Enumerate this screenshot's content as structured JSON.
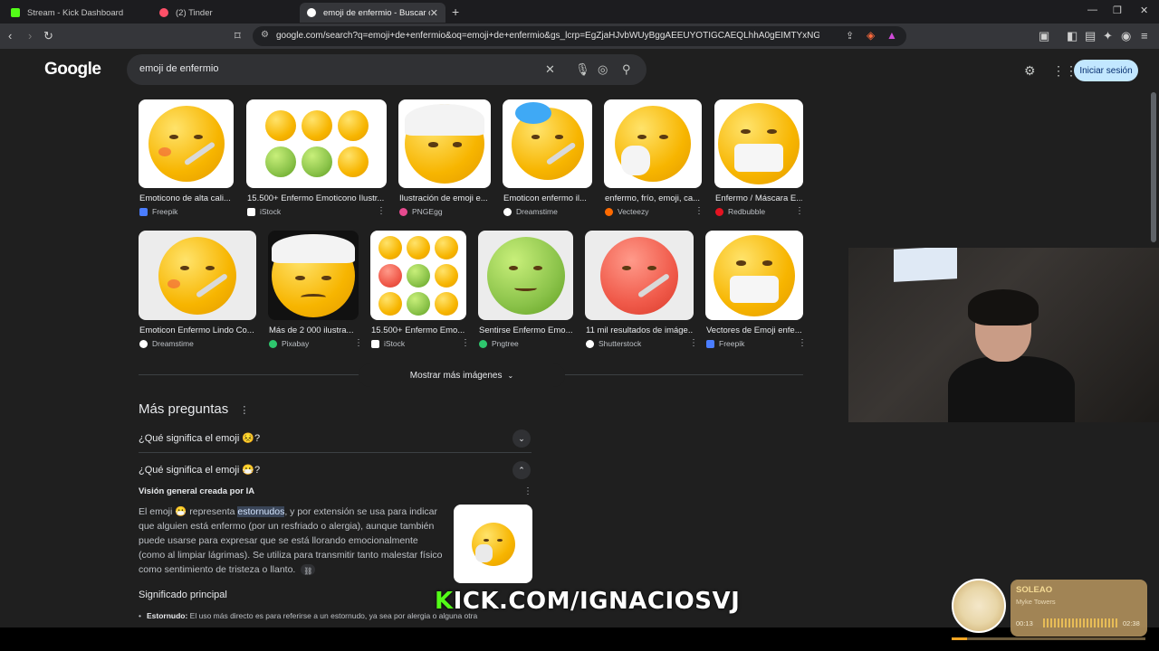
{
  "tabs": [
    {
      "label": "Stream - Kick Dashboard",
      "icon": "kick-icon"
    },
    {
      "label": "(2) Tinder",
      "icon": "tinder-icon"
    },
    {
      "label": "emoji de enfermio - Buscar con G",
      "icon": "google-icon"
    }
  ],
  "toolbar": {
    "url": "google.com/search?q=emoji+de+enfermio&oq=emoji+de+enfermio&gs_lcrp=EgZjaHJvbWUyBggAEEUYOTIGCAEQLhhA0gEIMTYxNGowajGoAgCw..."
  },
  "google": {
    "logo": "Google",
    "query": "emoji de enfermio",
    "signin": "Iniciar sesión"
  },
  "images": [
    {
      "caption": "Emoticono de alta cali...",
      "source": "Freepik",
      "src_color": "#4a7dff"
    },
    {
      "caption": "15.500+ Enfermo Emoticono Ilustr...",
      "source": "iStock",
      "src_color": "#ffffff"
    },
    {
      "caption": "Ilustración de emoji e...",
      "source": "PNGEgg",
      "src_color": "#e64a8f"
    },
    {
      "caption": "Emoticon enfermo il...",
      "source": "Dreamstime",
      "src_color": "#ffffff"
    },
    {
      "caption": "enfermo, frío, emoji, ca...",
      "source": "Vecteezy",
      "src_color": "#ff6a00"
    },
    {
      "caption": "Enfermo / Máscara E...",
      "source": "Redbubble",
      "src_color": "#e41321"
    },
    {
      "caption": "Emoticon Enfermo Lindo Co...",
      "source": "Dreamstime",
      "src_color": "#ffffff"
    },
    {
      "caption": "Más de 2 000 ilustra...",
      "source": "Pixabay",
      "src_color": "#2ec66d"
    },
    {
      "caption": "15.500+ Enfermo Emo...",
      "source": "iStock",
      "src_color": "#ffffff"
    },
    {
      "caption": "Sentirse Enfermo Emo...",
      "source": "Pngtree",
      "src_color": "#2ec66d"
    },
    {
      "caption": "11 mil resultados de imáge...",
      "source": "Shutterstock",
      "src_color": "#ffffff"
    },
    {
      "caption": "Vectores de Emoji enfe...",
      "source": "Freepik",
      "src_color": "#4a7dff"
    }
  ],
  "more_images": "Mostrar más imágenes",
  "paa": {
    "title": "Más preguntas",
    "q1": "¿Qué significa el emoji 😣?",
    "q2": "¿Qué significa el emoji 😷?",
    "ai_label": "Visión general creada por IA",
    "answer_pre": "El emoji 😷 representa ",
    "answer_hl": "estornudos",
    "answer_post": ", y por extensión se usa para indicar que alguien está enfermo (por un resfriado o alergia), aunque también puede usarse para expresar que se está llorando emocionalmente (como al limpiar lágrimas). Se utiliza para transmitir tanto malestar físico como sentimiento de tristeza o llanto.",
    "subhead": "Significado principal",
    "bullet_label": "Estornudo:",
    "bullet_text": " El uso más directo es para referirse a un estornudo, ya sea por alergia o alguna otra"
  },
  "overlay": {
    "kick_k": "K",
    "kick_rest": "ICK.COM/IGNACIOSVJ"
  },
  "music": {
    "title": "SOLEAO",
    "artist": "Myke Towers",
    "elapsed": "00:13",
    "total": "02:38",
    "progress": 0.08
  }
}
